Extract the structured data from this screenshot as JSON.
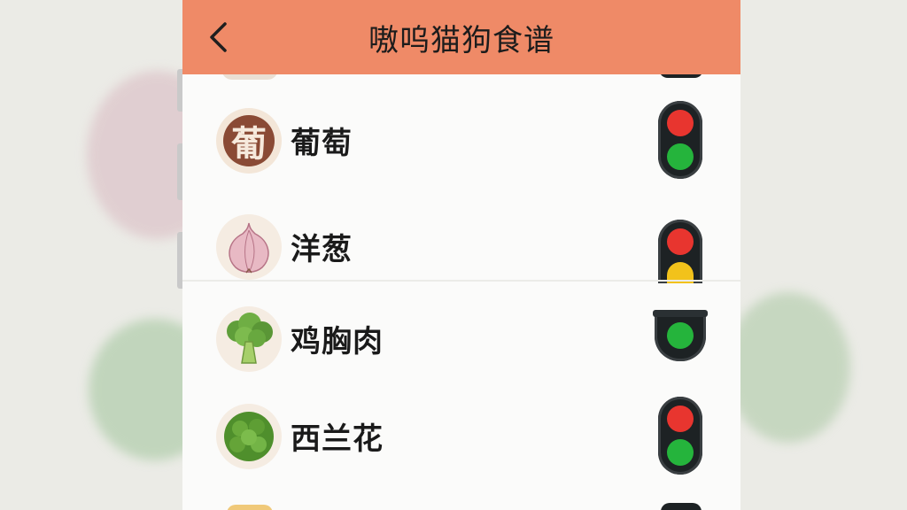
{
  "header": {
    "title": "嗷呜猫狗食谱",
    "back_icon": "chevron-left-icon"
  },
  "foods": [
    {
      "name": "葡萄",
      "thumb_glyph": "葡",
      "icon": "grape-text-icon",
      "lights": [
        "red",
        "green"
      ]
    },
    {
      "name": "洋葱",
      "icon": "onion-icon",
      "lights": [
        "red",
        "yellow"
      ]
    },
    {
      "name": "鸡胸肉",
      "icon": "broccoli-icon",
      "lights": [
        "green"
      ]
    },
    {
      "name": "西兰花",
      "icon": "green-vegetable-icon",
      "lights": [
        "red",
        "green"
      ]
    }
  ],
  "colors": {
    "header": "#ef8a67",
    "red_lamp": "#e8352f",
    "green_lamp": "#25b43c",
    "yellow_lamp": "#f2c21b"
  }
}
